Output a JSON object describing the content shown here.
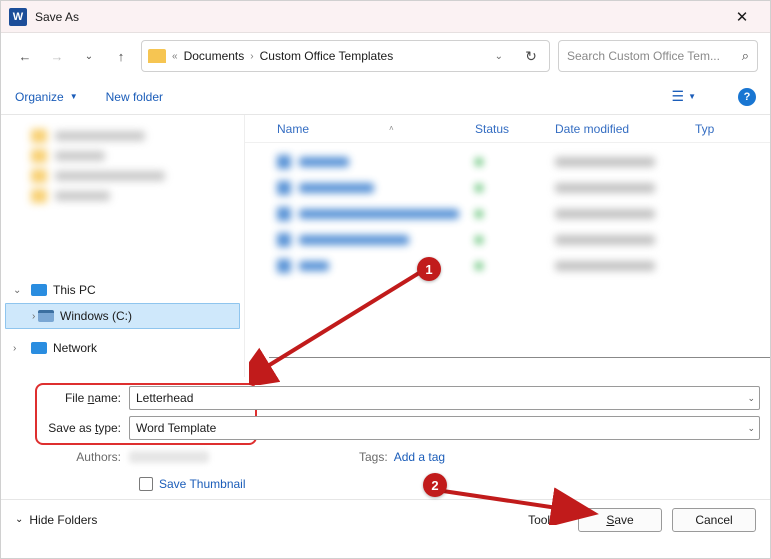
{
  "window": {
    "title": "Save As",
    "app_letter": "W"
  },
  "nav": {
    "breadcrumb": [
      "Documents",
      "Custom Office Templates"
    ],
    "search_placeholder": "Search Custom Office Tem..."
  },
  "toolbar": {
    "organize": "Organize",
    "newfolder": "New folder"
  },
  "columns": {
    "name": "Name",
    "status": "Status",
    "date": "Date modified",
    "type": "Typ"
  },
  "tree": {
    "thispc": "This PC",
    "drive": "Windows (C:)",
    "network": "Network"
  },
  "fields": {
    "filename_label_pre": "File ",
    "filename_label_ul": "n",
    "filename_label_post": "ame:",
    "filename_value": "Letterhead",
    "savetype_label_pre": "Save as ",
    "savetype_label_ul": "t",
    "savetype_label_post": "ype:",
    "savetype_value": "Word Template",
    "authors_label": "Authors:",
    "tags_label": "Tags:",
    "tags_link": "Add a tag",
    "thumb_label": "Save Thumbnail"
  },
  "footer": {
    "hidefolders": "Hide Folders",
    "tools": "Tools",
    "save_pre": "",
    "save_ul": "S",
    "save_post": "ave",
    "cancel": "Cancel"
  },
  "annotations": {
    "badge1": "1",
    "badge2": "2"
  }
}
